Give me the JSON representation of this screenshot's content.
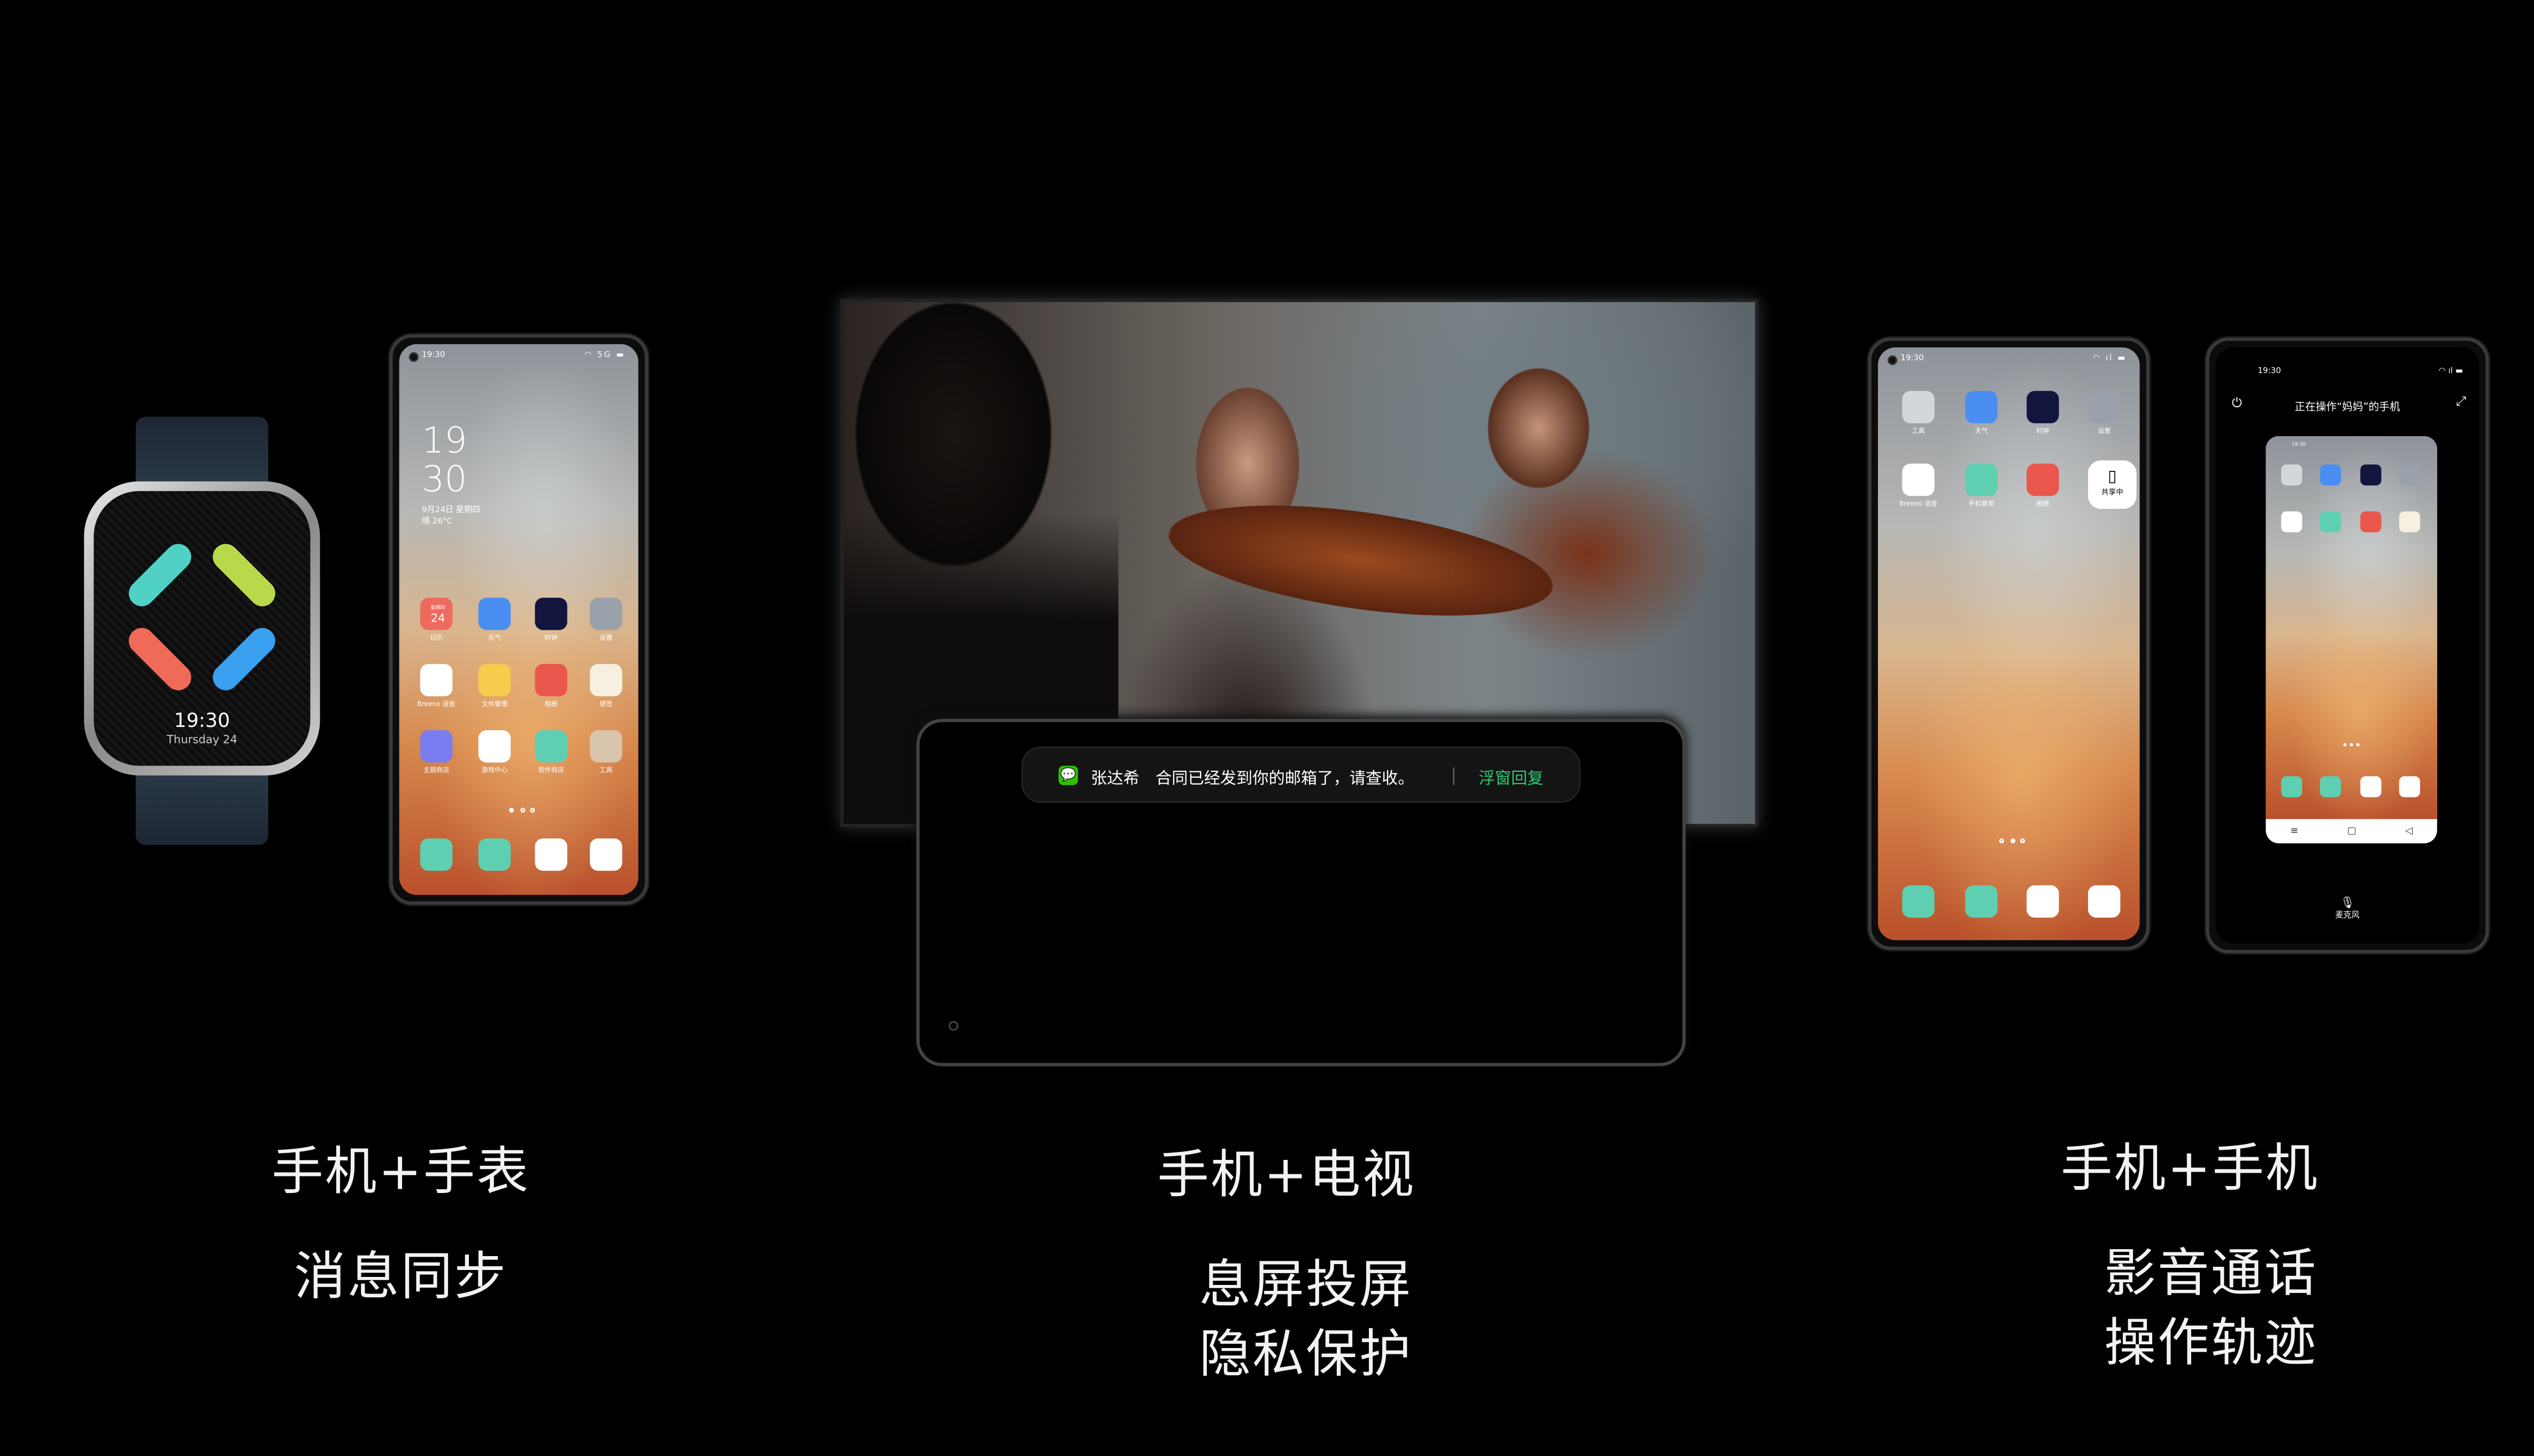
{
  "captions": {
    "watch": {
      "title": "手机+手表",
      "sub": [
        "消息同步"
      ]
    },
    "tv": {
      "title": "手机+电视",
      "sub": [
        "息屏投屏",
        "隐私保护"
      ]
    },
    "phone": {
      "title": "手机+手机",
      "sub": [
        "影音通话",
        "操作轨迹"
      ]
    }
  },
  "watch": {
    "time": "19:30",
    "date": "Thursday 24",
    "colors": [
      "#4fd1c5",
      "#b8d94a",
      "#f06a5a",
      "#3aa0f0"
    ]
  },
  "phone1": {
    "status_time": "19:30",
    "signal": "5G",
    "clock_hour": "19",
    "clock_min": "30",
    "date": "9月24日 星期四",
    "weather": "晴 26°C",
    "calendar_weekday": "星期四",
    "calendar_day": "24",
    "apps": [
      {
        "label": "日历",
        "icon": "calendar-icon",
        "color": "#ee6a5f"
      },
      {
        "label": "天气",
        "icon": "weather-icon",
        "color": "#4a8ef2"
      },
      {
        "label": "时钟",
        "icon": "clock-icon",
        "color": "#12163f"
      },
      {
        "label": "设置",
        "icon": "settings-icon",
        "color": "#9aa1ab"
      },
      {
        "label": "Breeno 语音",
        "icon": "breeno-icon",
        "color": "#ffffff"
      },
      {
        "label": "文件管理",
        "icon": "folder-icon",
        "color": "#f5cc4d"
      },
      {
        "label": "相册",
        "icon": "gallery-icon",
        "color": "#e9574d"
      },
      {
        "label": "便签",
        "icon": "notes-icon",
        "color": "#f7efe0"
      },
      {
        "label": "主题商店",
        "icon": "theme-store-icon",
        "color": "#7a7df0"
      },
      {
        "label": "游戏中心",
        "icon": "game-center-icon",
        "color": "#ffffff"
      },
      {
        "label": "软件商店",
        "icon": "app-store-icon",
        "color": "#5ecfb0"
      },
      {
        "label": "工具",
        "icon": "tools-folder-icon",
        "color": "#d9c4ad"
      }
    ],
    "dock": [
      {
        "icon": "phone-icon",
        "color": "#5ecfb0"
      },
      {
        "icon": "messages-icon",
        "color": "#5ecfb0"
      },
      {
        "icon": "browser-icon",
        "color": "#ffffff"
      },
      {
        "icon": "camera-icon",
        "color": "#ffffff"
      }
    ],
    "page": 1,
    "pages": 3
  },
  "tv": {
    "notification": {
      "sender": "张达希",
      "message": "合同已经发到你的邮箱了，请查收。",
      "action": "浮窗回复",
      "app_icon": "wechat-icon",
      "app_color": "#2dc100",
      "action_color": "#2ecb73"
    }
  },
  "phone3": {
    "status_time": "19:30",
    "apps": [
      {
        "label": "工具",
        "icon": "tools-folder-icon",
        "color": "#d3d6db"
      },
      {
        "label": "天气",
        "icon": "weather-icon",
        "color": "#4a8ef2"
      },
      {
        "label": "时钟",
        "icon": "clock-icon",
        "color": "#12163f"
      },
      {
        "label": "设置",
        "icon": "settings-icon",
        "color": "#9aa1ab"
      },
      {
        "label": "Breeno 语音",
        "icon": "breeno-icon",
        "color": "#ffffff"
      },
      {
        "label": "手机管家",
        "icon": "phone-manager-icon",
        "color": "#5ecfb0"
      },
      {
        "label": "相册",
        "icon": "gallery-icon",
        "color": "#e9574d"
      },
      {
        "label": "便签",
        "icon": "notes-icon",
        "color": "#f7efe0"
      }
    ],
    "sharing_badge": "共享中",
    "page": 2,
    "pages": 3
  },
  "phone4": {
    "status_time": "19:30",
    "header": "正在操作“妈妈”的手机",
    "mic_label": "麦克风",
    "mirror_time": "19:30"
  }
}
